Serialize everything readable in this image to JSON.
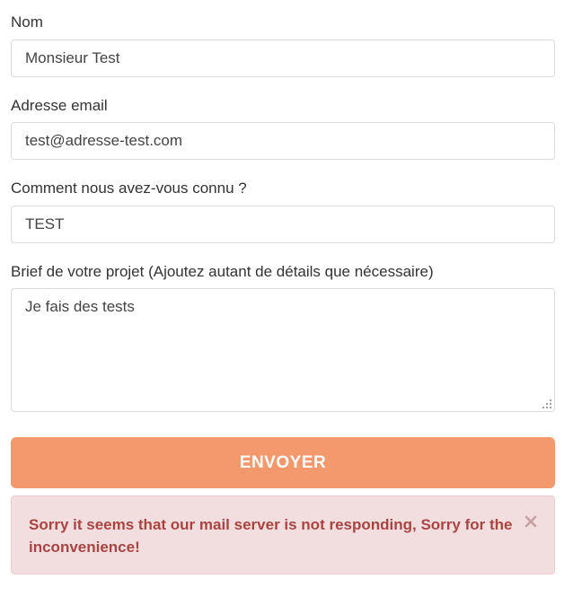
{
  "form": {
    "name": {
      "label": "Nom",
      "value": "Monsieur Test"
    },
    "email": {
      "label": "Adresse email",
      "value": "test@adresse-test.com"
    },
    "source": {
      "label": "Comment nous avez-vous connu ?",
      "value": "TEST"
    },
    "brief": {
      "label": "Brief de votre projet (Ajoutez autant de détails que nécessaire)",
      "value": "Je fais des tests"
    },
    "submit_label": "ENVOYER"
  },
  "alert": {
    "message": "Sorry it seems that our mail server is not responding, Sorry for the inconvenience!",
    "close_icon": "close-icon"
  },
  "colors": {
    "button": "#f3996d",
    "alert_bg": "#f2dede",
    "alert_text": "#a94442"
  }
}
